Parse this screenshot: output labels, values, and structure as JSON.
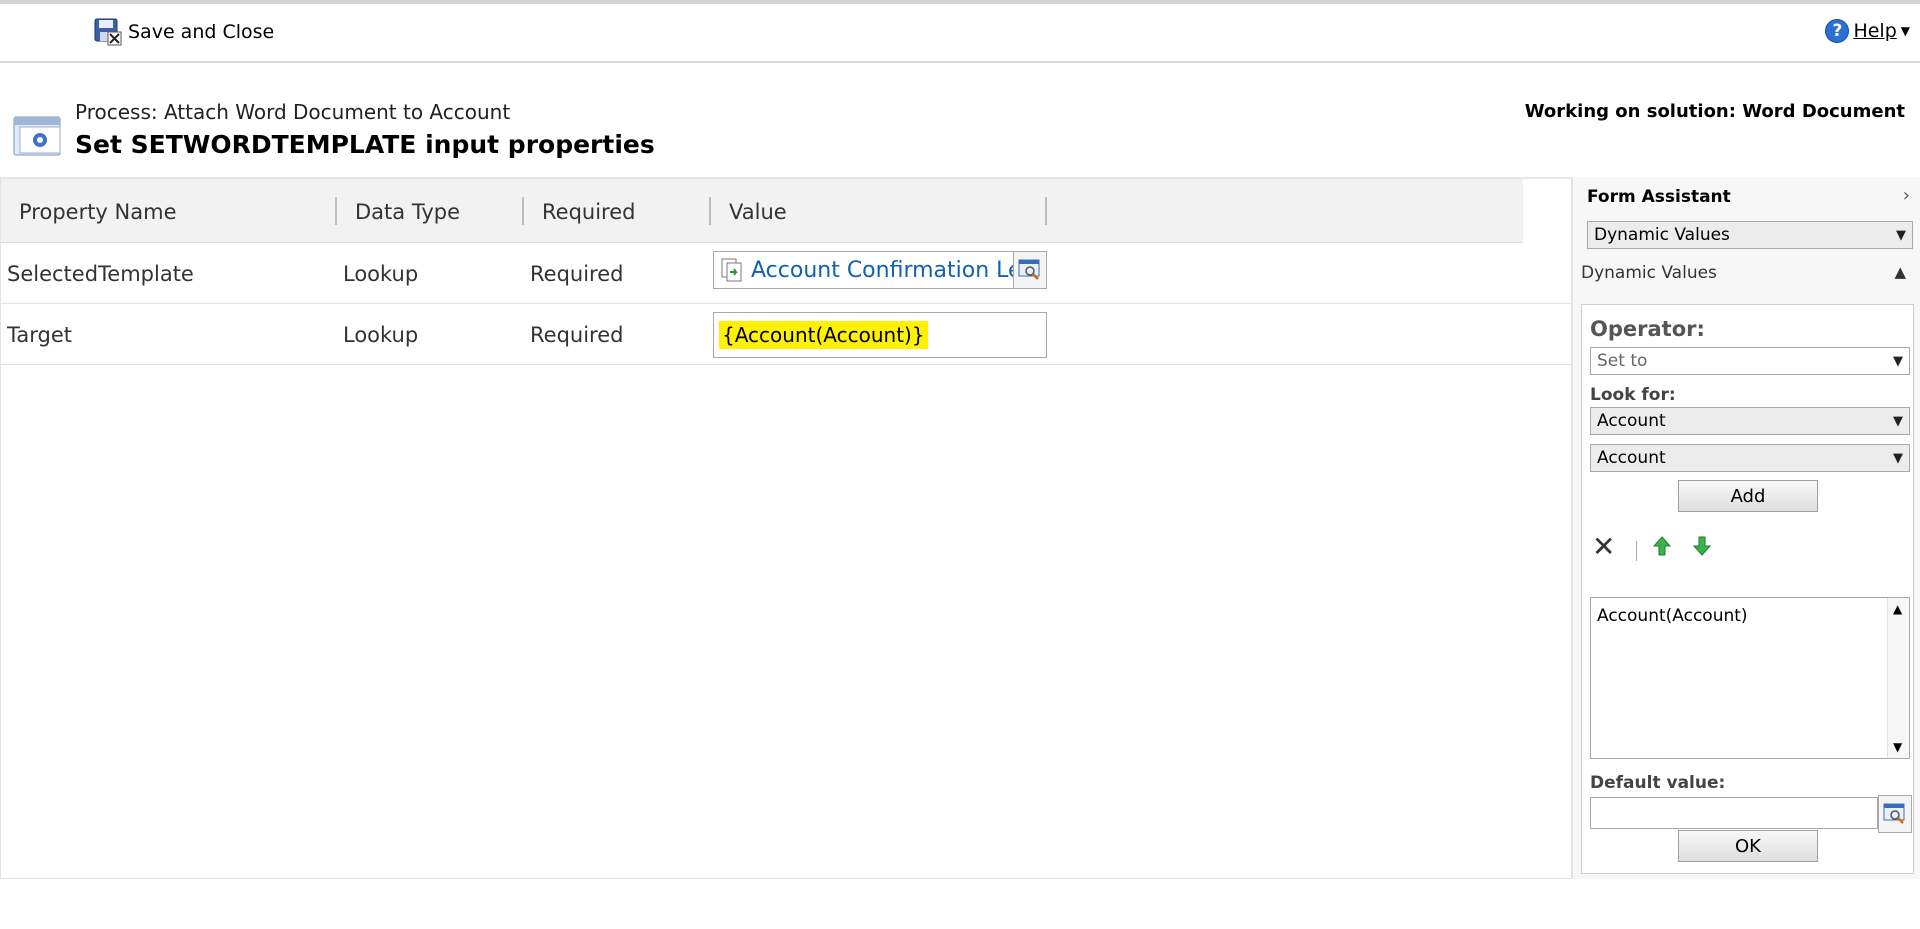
{
  "toolbar": {
    "save_close_label": "Save and Close",
    "help_label": "Help",
    "help_symbol": "?"
  },
  "header": {
    "process_name": "Process: Attach Word Document to Account",
    "title": "Set SETWORDTEMPLATE input properties",
    "solution": "Working on solution: Word Document"
  },
  "grid": {
    "columns": [
      "Property Name",
      "Data Type",
      "Required",
      "Value"
    ],
    "rows": [
      {
        "property": "SelectedTemplate",
        "type": "Lookup",
        "required": "Required",
        "value": "Account Confirmation Le"
      },
      {
        "property": "Target",
        "type": "Lookup",
        "required": "Required",
        "value": "{Account(Account)}"
      }
    ]
  },
  "form_assistant": {
    "title": "Form Assistant",
    "top_select": "Dynamic Values",
    "section_label": "Dynamic Values",
    "operator_label": "Operator:",
    "operator_value": "Set to",
    "look_for_label": "Look for:",
    "look_for_entity": "Account",
    "look_for_field": "Account",
    "add_label": "Add",
    "list_items": [
      "Account(Account)"
    ],
    "default_value_label": "Default value:",
    "default_value": "",
    "ok_label": "OK"
  },
  "colors": {
    "link": "#1160b7",
    "highlight": "#fff200",
    "help": "#2c6fd6"
  }
}
